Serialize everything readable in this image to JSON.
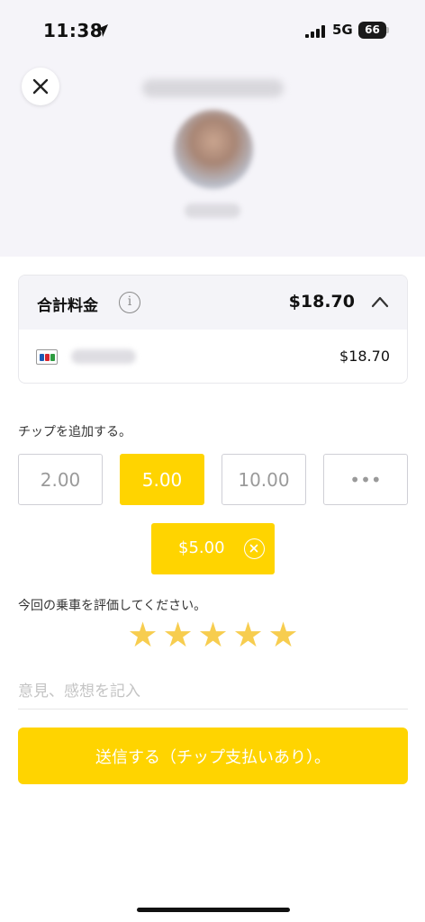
{
  "status_bar": {
    "time": "11:38",
    "network": "5G",
    "battery": "66"
  },
  "fare": {
    "title": "合計料金",
    "total": "$18.70",
    "payment_amount": "$18.70"
  },
  "tip": {
    "label": "チップを追加する。",
    "options": [
      "2.00",
      "5.00",
      "10.00",
      "•••"
    ],
    "selected_index": 1,
    "selected_amount": "$5.00"
  },
  "rating": {
    "label": "今回の乗車を評価してください。",
    "stars": 5,
    "star_glyph": "★"
  },
  "comment": {
    "placeholder": "意見、感想を記入"
  },
  "submit": {
    "label": "送信する（チップ支払いあり）。"
  },
  "colors": {
    "accent": "#ffd400",
    "star": "#f7cd4f",
    "header_bg": "#f5f4f9"
  }
}
